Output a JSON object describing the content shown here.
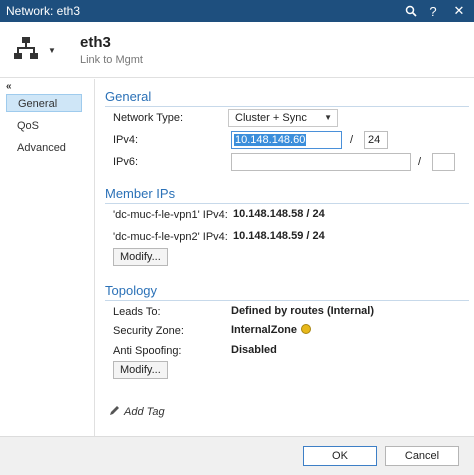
{
  "window": {
    "title": "Network: eth3",
    "help_icon": "question-icon",
    "close_icon": "close-icon",
    "search_icon": "search-icon"
  },
  "header": {
    "name": "eth3",
    "comment": "Link to Mgmt"
  },
  "sidebar": {
    "collapse_glyph": "«",
    "items": [
      {
        "label": "General",
        "active": true
      },
      {
        "label": "QoS",
        "active": false
      },
      {
        "label": "Advanced",
        "active": false
      }
    ]
  },
  "general": {
    "title": "General",
    "network_type_label": "Network Type:",
    "network_type_value": "Cluster + Sync",
    "ipv4_label": "IPv4:",
    "ipv4_value": "10.148.148.60",
    "ipv4_mask": "24",
    "ipv6_label": "IPv6:",
    "ipv6_value": "",
    "ipv6_mask": "",
    "slash": "/"
  },
  "member_ips": {
    "title": "Member IPs",
    "rows": [
      {
        "label": "'dc-muc-f-le-vpn1' IPv4:",
        "value": "10.148.148.58 / 24"
      },
      {
        "label": "'dc-muc-f-le-vpn2' IPv4:",
        "value": "10.148.148.59 / 24"
      }
    ],
    "modify_label": "Modify..."
  },
  "topology": {
    "title": "Topology",
    "leads_to_label": "Leads To:",
    "leads_to_value": "Defined by routes (Internal)",
    "security_zone_label": "Security Zone:",
    "security_zone_value": "InternalZone",
    "anti_spoofing_label": "Anti Spoofing:",
    "anti_spoofing_value": "Disabled",
    "modify_label": "Modify..."
  },
  "add_tag": {
    "label": "Add Tag"
  },
  "footer": {
    "ok_label": "OK",
    "cancel_label": "Cancel"
  },
  "colors": {
    "titlebar": "#1e4f7e",
    "section": "#2b71b7",
    "selection": "#3b8edb",
    "nav_active": "#cfe6f7",
    "zone_icon": "#e7b81a"
  }
}
